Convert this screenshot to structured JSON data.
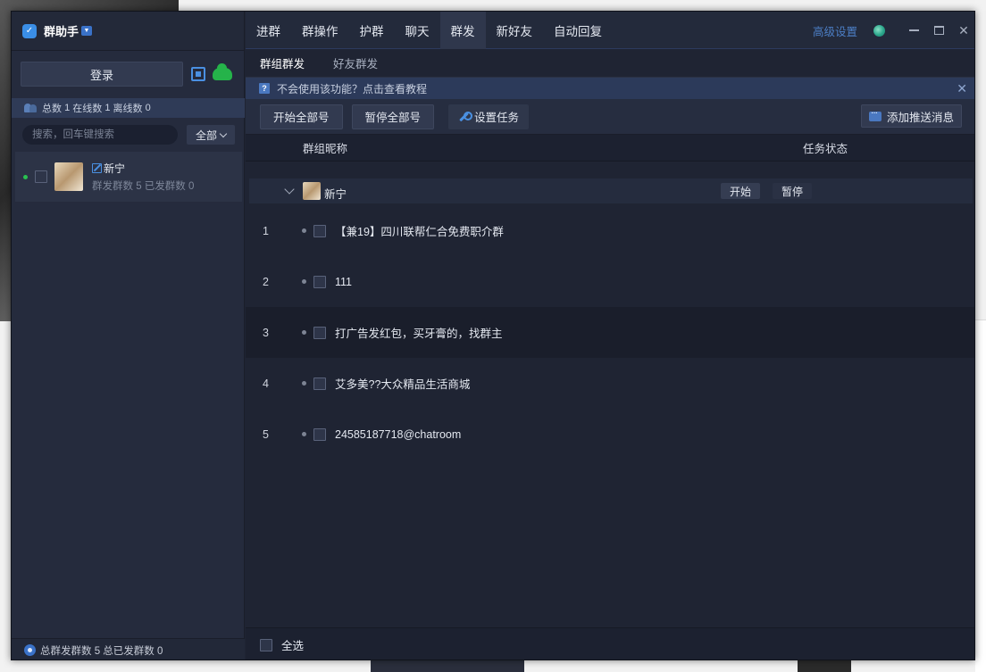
{
  "app": {
    "brand_name": "群助手",
    "brand_logo_glyph": "✓",
    "brand_caret": "▼"
  },
  "left": {
    "login_label": "登录",
    "stats": {
      "total_label": "总数",
      "total": "1",
      "online_label": "在线数",
      "online": "1",
      "offline_label": "离线数",
      "offline": "0"
    },
    "search_placeholder": "搜索，回车键搜索",
    "filter_value": "全部",
    "account": {
      "name": "新宁",
      "sub": "群发群数 5 已发群数 0",
      "status_color": "#29c150"
    },
    "footer": "总群发群数 5 总已发群数 0"
  },
  "topnav": {
    "items": [
      {
        "label": "进群"
      },
      {
        "label": "群操作"
      },
      {
        "label": "护群"
      },
      {
        "label": "聊天"
      },
      {
        "label": "群发"
      },
      {
        "label": "新好友"
      },
      {
        "label": "自动回复"
      }
    ],
    "active": "群发",
    "advanced": "高级设置",
    "close_glyph": "✕"
  },
  "subtabs": [
    {
      "label": "群组群发"
    },
    {
      "label": "好友群发"
    }
  ],
  "banner": {
    "text": "不会使用该功能？点击查看教程",
    "q_glyph": "?",
    "close_glyph": "✕"
  },
  "toolbar": {
    "start_all": "开始全部号",
    "pause_all": "暂停全部号",
    "set_task": "设置任务",
    "add_push": "添加推送消息"
  },
  "table": {
    "col_name": "群组昵称",
    "col_status": "任务状态",
    "group": {
      "name": "新宁",
      "start_label": "开始",
      "pause_label": "暂停"
    },
    "rows": [
      {
        "index": "1",
        "name": "【兼19】四川联帮仁合免费职介群"
      },
      {
        "index": "2",
        "name": "111"
      },
      {
        "index": "3",
        "name": "打广告发红包，买牙膏的，找群主"
      },
      {
        "index": "4",
        "name": "艾多美??大众精品生活商城"
      },
      {
        "index": "5",
        "name": "24585187718@chatroom"
      }
    ]
  },
  "footer": {
    "select_all": "全选"
  },
  "colors": {
    "accent": "#4a90e2",
    "online": "#29c150",
    "panel_bg": "#1f2433"
  }
}
